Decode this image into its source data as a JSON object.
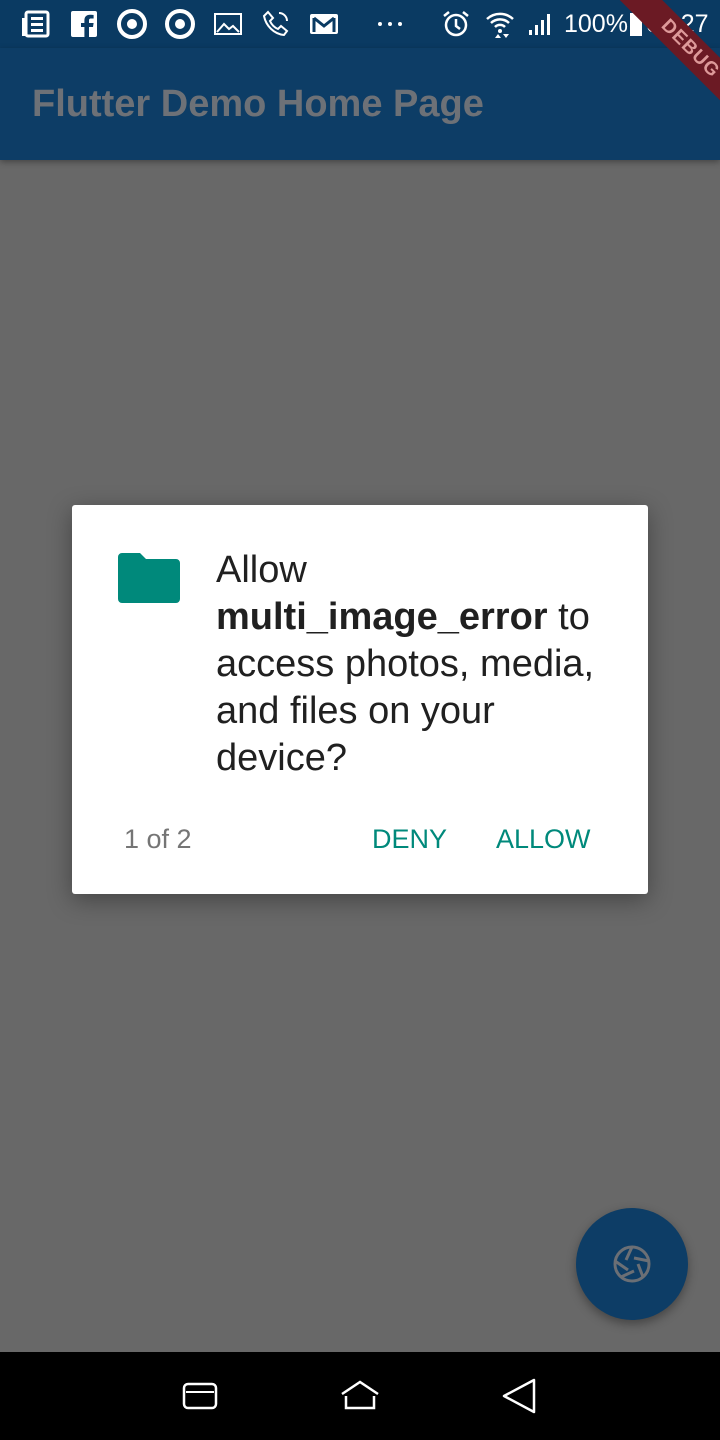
{
  "status_bar": {
    "icons": [
      "news-icon",
      "facebook-icon",
      "chrome-icon",
      "chrome-icon",
      "image-icon",
      "phone-icon",
      "gmail-icon",
      "more-icon",
      "alarm-icon",
      "wifi-icon",
      "signal-icon",
      "battery-icon"
    ],
    "battery": "100%",
    "time": "05:27"
  },
  "debug_banner": "DEBUG",
  "app_bar": {
    "title": "Flutter Demo Home Page"
  },
  "dialog": {
    "icon": "folder-icon",
    "message_prefix": "Allow",
    "app_name": "multi_image_error",
    "message_suffix": "to access photos, media, and files on your device?",
    "counter": "1 of 2",
    "deny_label": "DENY",
    "allow_label": "ALLOW"
  },
  "fab": {
    "icon": "camera-shutter-icon"
  },
  "nav_bar": {
    "buttons": [
      "recents-icon",
      "home-icon",
      "back-icon"
    ]
  },
  "colors": {
    "primary": "#0d3d66",
    "scrim_background": "#686868",
    "dialog_accent": "#00897b"
  }
}
